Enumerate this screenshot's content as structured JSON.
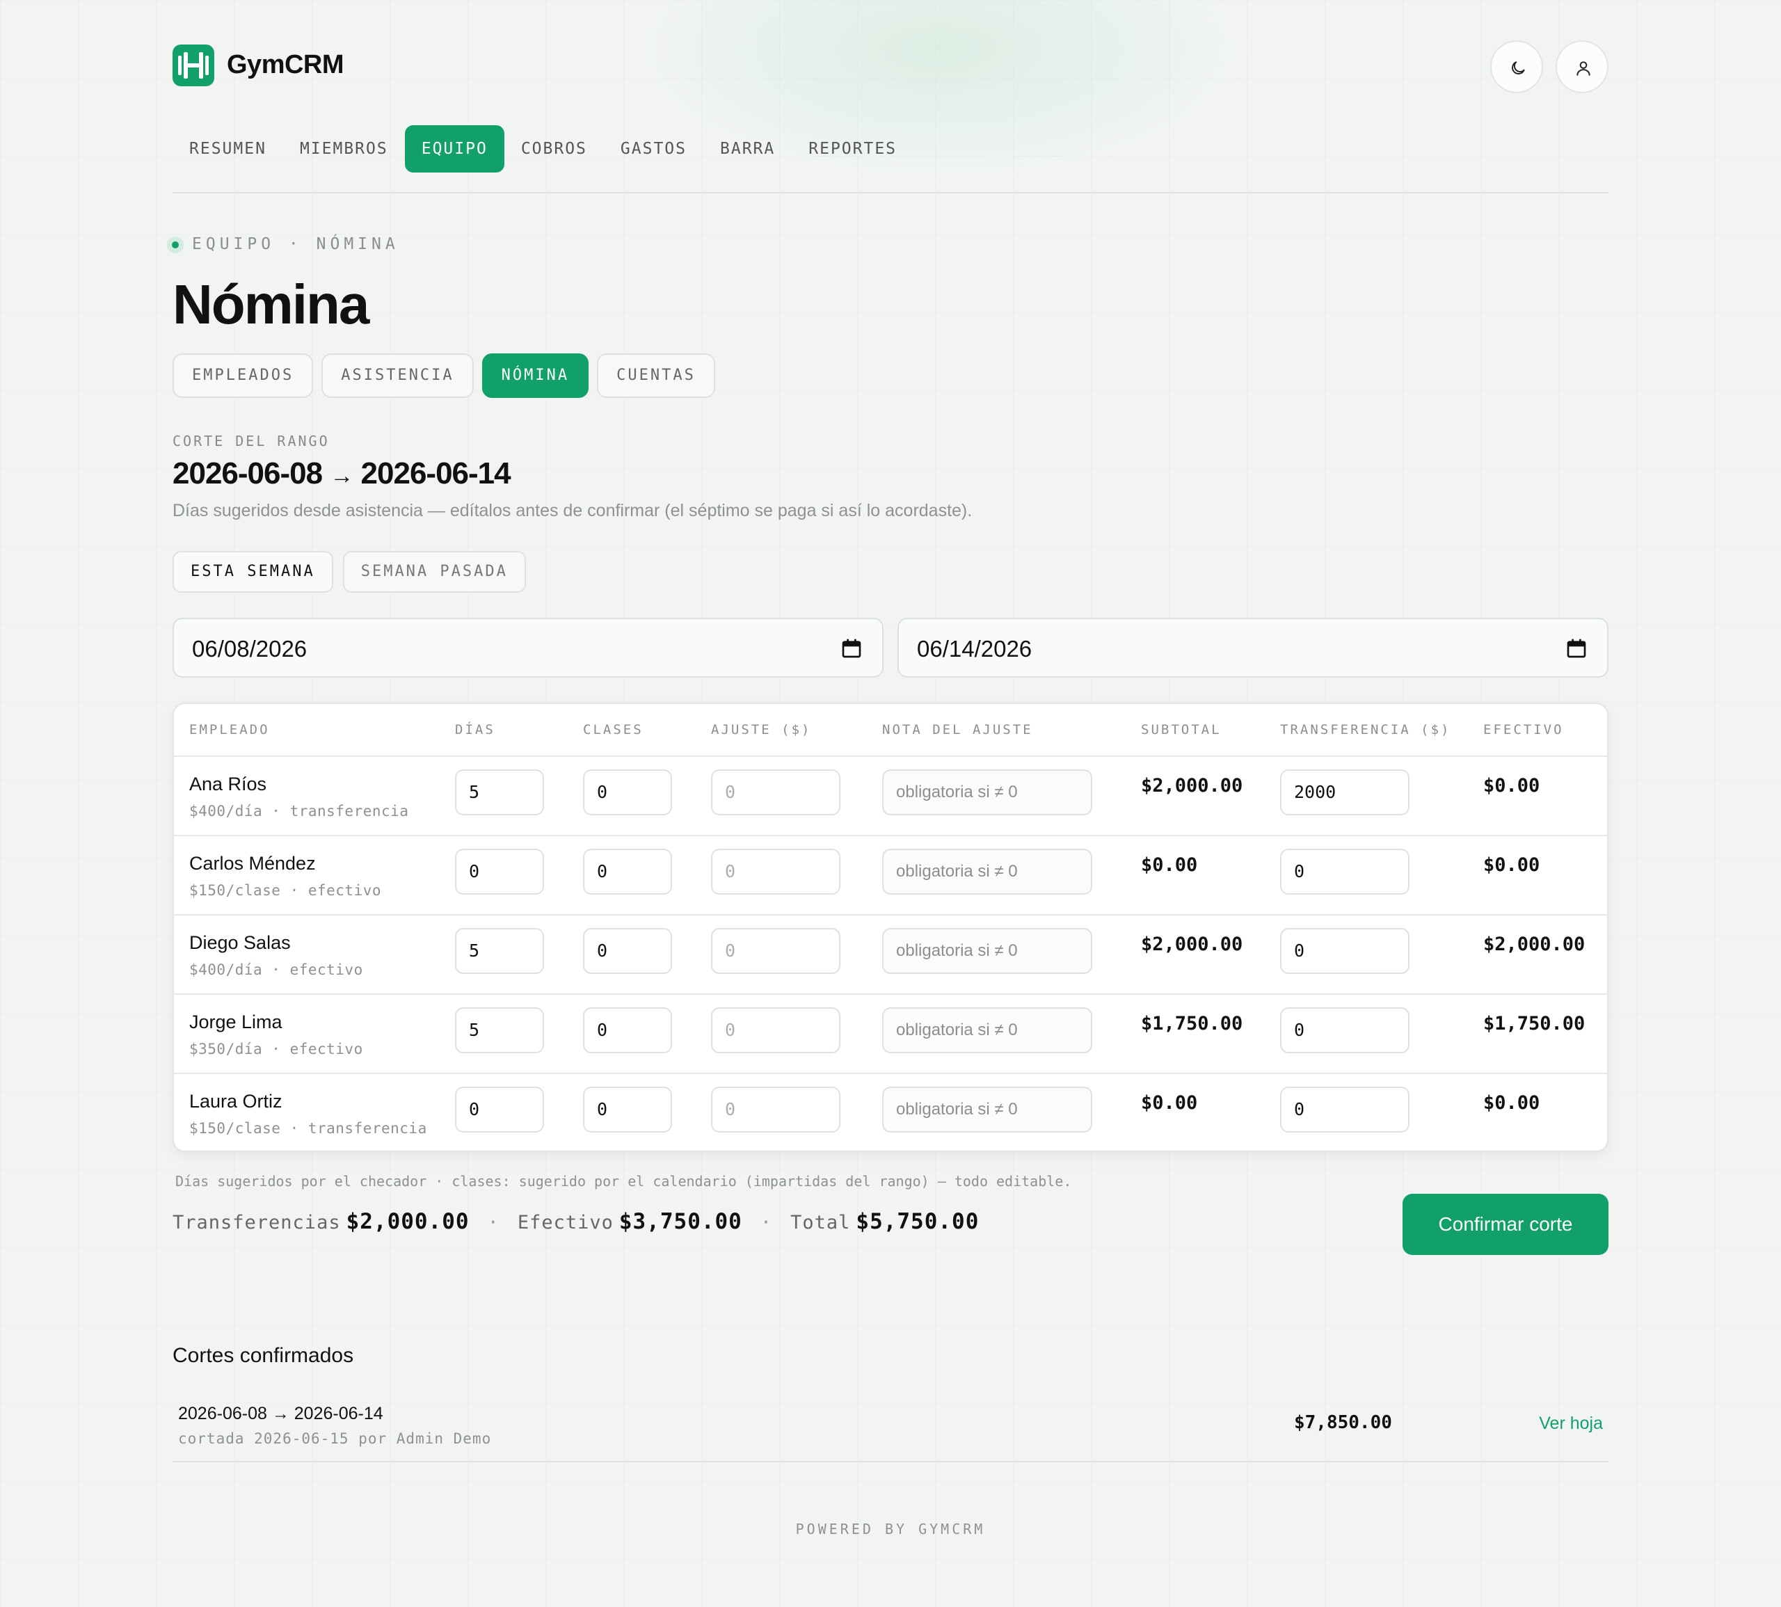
{
  "app": {
    "name": "GymCRM"
  },
  "header": {
    "theme_icon": "moon-icon",
    "user_icon": "user-icon"
  },
  "nav": [
    {
      "label": "RESUMEN"
    },
    {
      "label": "MIEMBROS"
    },
    {
      "label": "EQUIPO",
      "active": true
    },
    {
      "label": "COBROS"
    },
    {
      "label": "GASTOS"
    },
    {
      "label": "BARRA"
    },
    {
      "label": "REPORTES"
    }
  ],
  "breadcrumb": "EQUIPO · NÓMINA",
  "page_title": "Nómina",
  "subtabs": [
    {
      "label": "EMPLEADOS"
    },
    {
      "label": "ASISTENCIA"
    },
    {
      "label": "NÓMINA",
      "active": true
    },
    {
      "label": "CUENTAS"
    }
  ],
  "range": {
    "label": "CORTE DEL RANGO",
    "start": "2026-06-08",
    "arrow": "→",
    "end": "2026-06-14",
    "description": "Días sugeridos desde asistencia — edítalos antes de confirmar (el séptimo se paga si así lo acordaste).",
    "presets": [
      "ESTA SEMANA",
      "SEMANA PASADA"
    ],
    "date_from": "06/08/2026",
    "date_to": "06/14/2026"
  },
  "table": {
    "headers": [
      "EMPLEADO",
      "DÍAS",
      "CLASES",
      "AJUSTE ($)",
      "NOTA DEL AJUSTE",
      "SUBTOTAL",
      "TRANSFERENCIA ($)",
      "EFECTIVO"
    ],
    "note_placeholder": "obligatoria si ≠ 0",
    "adjust_placeholder": "0",
    "rows": [
      {
        "name": "Ana Ríos",
        "sub": "$400/día · transferencia",
        "dias": "5",
        "clases": "0",
        "subtotal": "$2,000.00",
        "transferencia": "2000",
        "efectivo": "$0.00"
      },
      {
        "name": "Carlos Méndez",
        "sub": "$150/clase · efectivo",
        "dias": "0",
        "clases": "0",
        "subtotal": "$0.00",
        "transferencia": "0",
        "efectivo": "$0.00"
      },
      {
        "name": "Diego Salas",
        "sub": "$400/día · efectivo",
        "dias": "5",
        "clases": "0",
        "subtotal": "$2,000.00",
        "transferencia": "0",
        "efectivo": "$2,000.00"
      },
      {
        "name": "Jorge Lima",
        "sub": "$350/día · efectivo",
        "dias": "5",
        "clases": "0",
        "subtotal": "$1,750.00",
        "transferencia": "0",
        "efectivo": "$1,750.00"
      },
      {
        "name": "Laura Ortiz",
        "sub": "$150/clase · transferencia",
        "dias": "0",
        "clases": "0",
        "subtotal": "$0.00",
        "transferencia": "0",
        "efectivo": "$0.00"
      }
    ],
    "footnote": "Días sugeridos por el checador · clases: sugerido por el calendario (impartidas del rango) — todo editable."
  },
  "totals": {
    "transfer_label": "Transferencias",
    "transfer_value": "$2,000.00",
    "cash_label": "Efectivo",
    "cash_value": "$3,750.00",
    "total_label": "Total",
    "total_value": "$5,750.00",
    "separator": "·"
  },
  "confirm_label": "Confirmar corte",
  "history": {
    "title": "Cortes confirmados",
    "items": [
      {
        "range": "2026-06-08 → 2026-06-14",
        "sub": "cortada 2026-06-15 por Admin Demo",
        "amount": "$7,850.00",
        "link": "Ver hoja"
      }
    ]
  },
  "footer": "POWERED BY GYMCRM",
  "colors": {
    "accent": "#12a06a",
    "background": "#f2f4f3"
  }
}
